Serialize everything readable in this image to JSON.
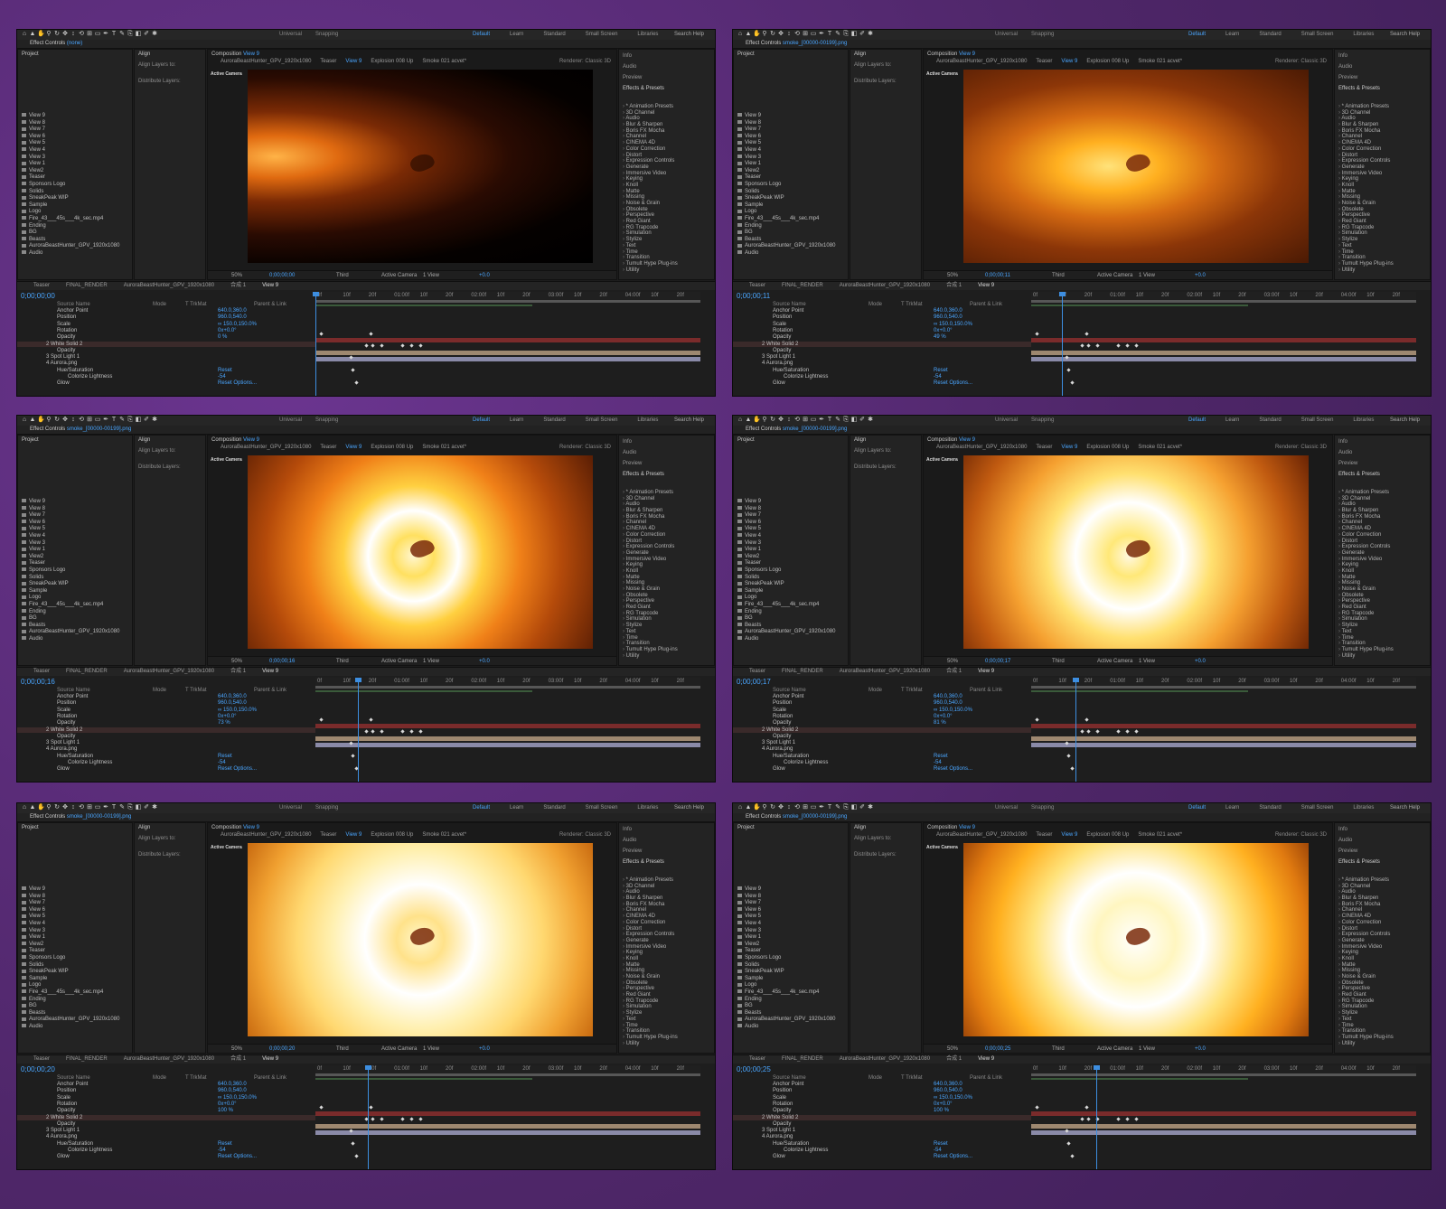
{
  "app": {
    "universal": "Universal",
    "snapping": "Snapping",
    "workspaces": [
      "Default",
      "Learn",
      "Standard",
      "Small Screen",
      "Libraries"
    ],
    "active_workspace_index": 0,
    "search": "Search Help"
  },
  "panels": {
    "project_title": "Project",
    "align_title": "Align",
    "align_to": "Align Layers to:",
    "distribute": "Distribute Layers:",
    "info": "Info",
    "audio": "Audio",
    "preview": "Preview",
    "effects_presets": "Effects & Presets",
    "composition_prefix": "Composition",
    "composition_name": "View 9",
    "active_camera": "Active Camera",
    "renderer": "Renderer:  Classic 3D"
  },
  "comp_tabs": [
    "AuroraBeastHunter_GPV_1920x1080",
    "Teaser",
    "View 9",
    "Explosion 008 Up",
    "Smoke 021 acvet*"
  ],
  "project_items": [
    "View 9",
    "View 8",
    "View 7",
    "View 6",
    "View 5",
    "View 4",
    "View 3",
    "View 1",
    "View2",
    "Teaser",
    "Sponsors Logo",
    "Solids",
    "SneakPeak WIP",
    "Sample",
    "Logo",
    "Fire_43___45s___4k_sec.mp4",
    "Ending",
    "BG",
    "Beasts",
    "AuroraBeastHunter_GPV_1920x1080",
    "Audio"
  ],
  "effects_list": [
    "* Animation Presets",
    "3D Channel",
    "Audio",
    "Blur & Sharpen",
    "Boris FX Mocha",
    "Channel",
    "CINEMA 4D",
    "Color Correction",
    "Distort",
    "Expression Controls",
    "Generate",
    "Immersive Video",
    "Keying",
    "Knoll",
    "Matte",
    "Missing",
    "Noise & Grain",
    "Obsolete",
    "Perspective",
    "Red Giant",
    "RG Trapcode",
    "Simulation",
    "Stylize",
    "Text",
    "Time",
    "Transition",
    "Tumult Hype Plug-ins",
    "Utility"
  ],
  "viewer_bar": {
    "zoom": "50%",
    "camera": "Third",
    "view_camera": "Active Camera",
    "views": "1 View",
    "exposure": "+0.0"
  },
  "timeline": {
    "tabs": [
      "Teaser",
      "FINAL_RENDER",
      "AuroraBeastHunter_GPV_1920x1080",
      "合成 1",
      "View 9"
    ],
    "active_tab_index": 4,
    "ruler": [
      "0f",
      "10f",
      "20f",
      "01:00f",
      "10f",
      "20f",
      "02:00f",
      "10f",
      "20f",
      "03:00f",
      "10f",
      "20f",
      "04:00f",
      "10f",
      "20f"
    ],
    "columns": [
      "Source Name",
      "Mode",
      "T TrkMat",
      "Parent & Link"
    ],
    "rows": [
      {
        "label": "Anchor Point",
        "value": "640.0,360.0",
        "indent": 2
      },
      {
        "label": "Position",
        "value": "960.0,540.0",
        "indent": 2
      },
      {
        "label": "Scale",
        "value": "∞ 150.0,150.0%",
        "indent": 2
      },
      {
        "label": "Rotation",
        "value": "0x+0.0°",
        "indent": 2
      },
      {
        "label": "Opacity",
        "value": "",
        "indent": 2
      },
      {
        "label": "2   White Solid 2",
        "value": "",
        "indent": 1
      },
      {
        "label": "Opacity",
        "value": "",
        "indent": 2
      },
      {
        "label": "3   Spot Light 1",
        "value": "",
        "indent": 1
      },
      {
        "label": "4   Aurora.png",
        "value": "",
        "indent": 1
      },
      {
        "label": "Hue/Saturation",
        "value": "Reset",
        "indent": 2
      },
      {
        "label": "Colorize Lightness",
        "value": "-54",
        "indent": 3
      },
      {
        "label": "Glow",
        "value": "Reset   Options...",
        "indent": 2
      }
    ]
  },
  "frames": [
    {
      "fx_name": "(none)",
      "timecode": "0;00;00;00",
      "opacity": "0 %",
      "playhead": 0.0
    },
    {
      "fx_name": "smoke_[00000-00199].png",
      "timecode": "0;00;00;11",
      "opacity": "49 %",
      "playhead": 0.08
    },
    {
      "fx_name": "smoke_[00000-00199].png",
      "timecode": "0;00;00;16",
      "opacity": "73 %",
      "playhead": 0.11
    },
    {
      "fx_name": "smoke_[00000-00199].png",
      "timecode": "0;00;00;17",
      "opacity": "81 %",
      "playhead": 0.115
    },
    {
      "fx_name": "smoke_[00000-00199].png",
      "timecode": "0;00;00;20",
      "opacity": "100 %",
      "playhead": 0.135
    },
    {
      "fx_name": "smoke_[00000-00199].png",
      "timecode": "0;00;00;25",
      "opacity": "100 %",
      "playhead": 0.17
    }
  ],
  "colors": {
    "accent": "#4aa6ff",
    "background": "#5a2d78",
    "panel": "#232323"
  }
}
